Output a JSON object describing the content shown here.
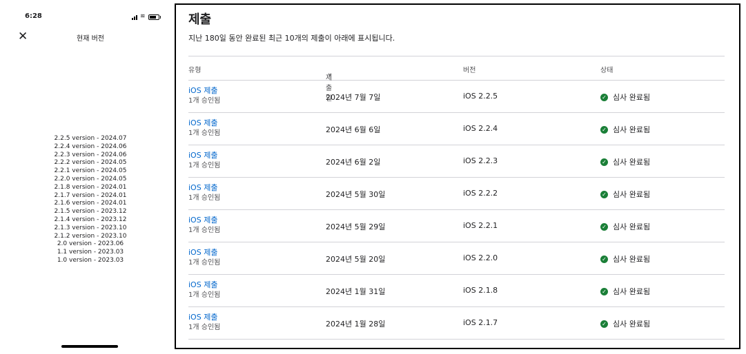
{
  "phone": {
    "time": "6:28",
    "nav_title": "현재 버전",
    "close_label": "✕",
    "icons": [
      "signal-icon",
      "wifi-icon",
      "battery-icon",
      "close-icon"
    ],
    "versions": [
      "2.2.5 version - 2024.07",
      "2.2.4 version - 2024.06",
      "2.2.3 version - 2024.06",
      "2.2.2 version - 2024.05",
      "2.2.1 version - 2024.05",
      "2.2.0 version - 2024.05",
      "2.1.8 version - 2024.01",
      "2.1.7 version - 2024.01",
      "2.1.6 version - 2024.01",
      "2.1.5 version - 2023.12",
      "2.1.4 version - 2023.12",
      "2.1.3 version - 2023.10",
      "2.1.2 version - 2023.10",
      "2.0 version - 2023.06",
      "1.1 version - 2023.03",
      "1.0 version - 2023.03"
    ]
  },
  "panel": {
    "title": "제출",
    "description": "지난 180일 동안 완료된 최근 10개의 제출이 아래에 표시됩니다.",
    "columns": {
      "type": "유형",
      "date": "제출일",
      "version": "버전",
      "status": "상태"
    },
    "sort_indicator": "∨",
    "colors": {
      "link": "#0066cc",
      "success": "#1a7f37"
    },
    "rows": [
      {
        "type": "iOS 제출",
        "sub": "1개 승인됨",
        "date": "2024년 7월 7일",
        "version": "iOS 2.2.5",
        "status": "심사 완료됨"
      },
      {
        "type": "iOS 제출",
        "sub": "1개 승인됨",
        "date": "2024년 6월 6일",
        "version": "iOS 2.2.4",
        "status": "심사 완료됨"
      },
      {
        "type": "iOS 제출",
        "sub": "1개 승인됨",
        "date": "2024년 6월 2일",
        "version": "iOS 2.2.3",
        "status": "심사 완료됨"
      },
      {
        "type": "iOS 제출",
        "sub": "1개 승인됨",
        "date": "2024년 5월 30일",
        "version": "iOS 2.2.2",
        "status": "심사 완료됨"
      },
      {
        "type": "iOS 제출",
        "sub": "1개 승인됨",
        "date": "2024년 5월 29일",
        "version": "iOS 2.2.1",
        "status": "심사 완료됨"
      },
      {
        "type": "iOS 제출",
        "sub": "1개 승인됨",
        "date": "2024년 5월 20일",
        "version": "iOS 2.2.0",
        "status": "심사 완료됨"
      },
      {
        "type": "iOS 제출",
        "sub": "1개 승인됨",
        "date": "2024년 1월 31일",
        "version": "iOS 2.1.8",
        "status": "심사 완료됨"
      },
      {
        "type": "iOS 제출",
        "sub": "1개 승인됨",
        "date": "2024년 1월 28일",
        "version": "iOS 2.1.7",
        "status": "심사 완료됨"
      }
    ]
  }
}
